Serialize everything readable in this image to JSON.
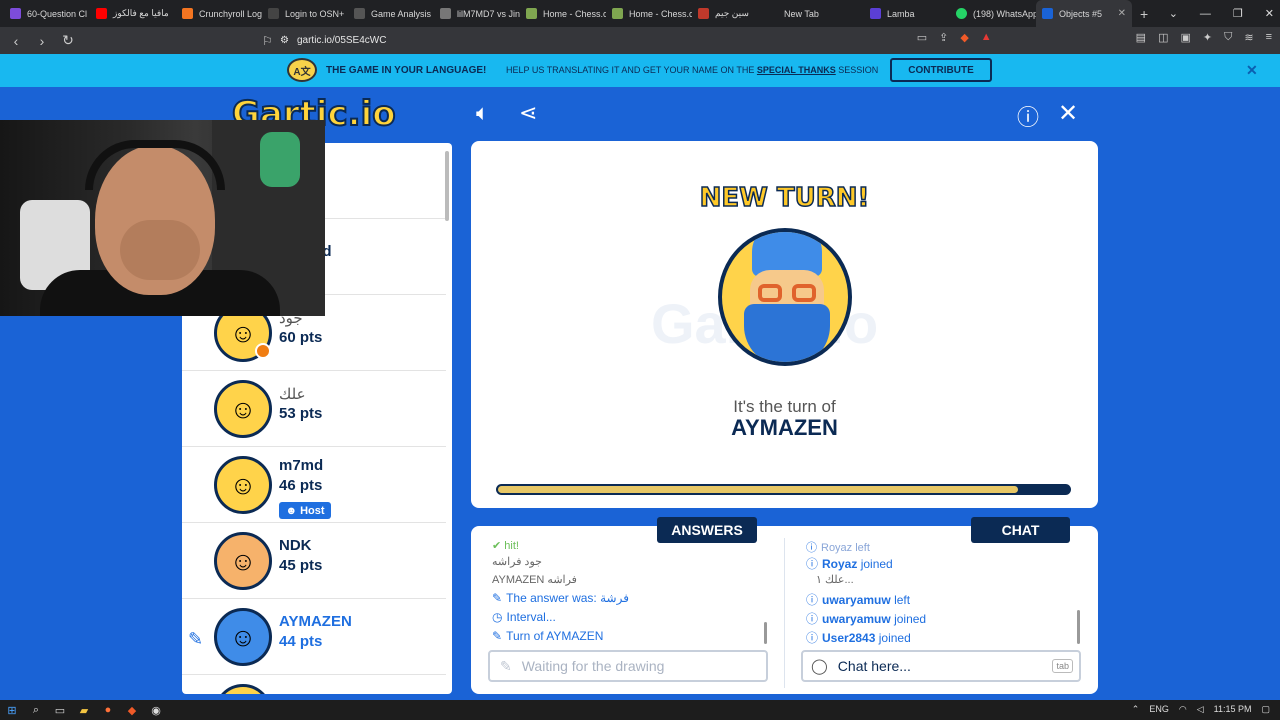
{
  "browser": {
    "tabs": [
      {
        "title": "60-Question Cl",
        "color": "#7d4cdb"
      },
      {
        "title": "مافيا مع فالكوز",
        "color": "#ff0000"
      },
      {
        "title": "Crunchyroll Log",
        "color": "#f47521"
      },
      {
        "title": "Login to OSN+",
        "color": "#222222"
      },
      {
        "title": "Game Analysis",
        "color": "#333333"
      },
      {
        "title": "lilM7MD7 vs Jin",
        "color": "#777777"
      },
      {
        "title": "Home - Chess.c",
        "color": "#7fa650"
      },
      {
        "title": "Home - Chess.c",
        "color": "#7fa650"
      },
      {
        "title": "سين جيم",
        "color": "#c0392b"
      },
      {
        "title": "New Tab",
        "color": "#202124"
      },
      {
        "title": "Lamba",
        "color": "#5b3fd6"
      },
      {
        "title": "(198) WhatsApp",
        "color": "#25d366"
      },
      {
        "title": "Objects #5",
        "color": "#1a63d6"
      }
    ],
    "url": "gartic.io/05SE4cWC"
  },
  "banner": {
    "lang_icon": "A文",
    "headline": "THE GAME IN YOUR LANGUAGE!",
    "text_before": "HELP US TRANSLATING IT AND GET YOUR NAME ON THE",
    "link": "SPECIAL THANKS",
    "text_after": "SESSION",
    "button": "CONTRIBUTE"
  },
  "game": {
    "logo": "Gartic.io",
    "new_turn": "NEW TURN!",
    "turn_of": "It's the turn of",
    "turn_player": "AYMAZEN",
    "progress": 0.91,
    "watermark": "Gartic.io"
  },
  "players": [
    {
      "name": "z",
      "pts": "",
      "partial": true
    },
    {
      "name": "ed",
      "pts": "",
      "partial": true
    },
    {
      "name": "جود",
      "pts": "60 pts",
      "dot": true
    },
    {
      "name": "علك",
      "pts": "53 pts"
    },
    {
      "name": "m7md",
      "pts": "46 pts",
      "host": "Host"
    },
    {
      "name": "NDK",
      "pts": "45 pts"
    },
    {
      "name": "AYMAZEN",
      "pts": "44 pts",
      "drawing": true
    }
  ],
  "answers": {
    "label": "ANSWERS",
    "lines": [
      {
        "text": "hit!"
      },
      {
        "text": "جود فراشه"
      },
      {
        "text": "AYMAZEN فراشه"
      },
      {
        "text": "The answer was: فرشة"
      },
      {
        "text": "Interval..."
      },
      {
        "text": "Turn of AYMAZEN"
      }
    ],
    "placeholder": "Waiting for the drawing"
  },
  "chat": {
    "label": "CHAT",
    "lines": [
      {
        "text": "Royaz left"
      },
      {
        "name": "Royaz",
        "text": "joined"
      },
      {
        "text": "علك ١..."
      },
      {
        "name": "uwaryamuw",
        "text": "left"
      },
      {
        "name": "uwaryamuw",
        "text": "joined"
      },
      {
        "name": "User2843",
        "text": "joined"
      }
    ],
    "placeholder": "Chat here...",
    "tab_hint": "tab"
  },
  "taskbar": {
    "lang": "ENG",
    "time": "11:15 PM"
  }
}
